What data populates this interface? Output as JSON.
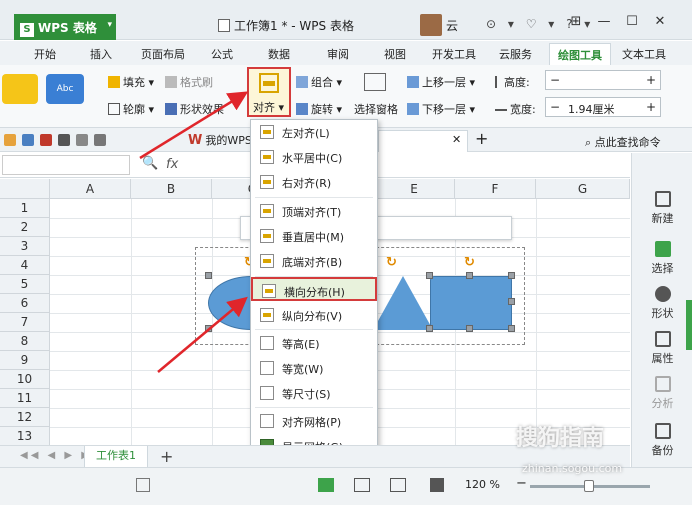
{
  "app": {
    "name": "WPS 表格",
    "logo": "S",
    "document_title": "工作簿1 * - WPS 表格",
    "user": "云",
    "title_icons": "⊙ ▾ ♡ ▾ ? ▾",
    "window_buttons": [
      "⊞",
      "—",
      "☐",
      "✕"
    ]
  },
  "tabs": [
    {
      "label": "开始"
    },
    {
      "label": "插入"
    },
    {
      "label": "页面布局"
    },
    {
      "label": "公式"
    },
    {
      "label": "数据"
    },
    {
      "label": "审阅"
    },
    {
      "label": "视图"
    },
    {
      "label": "开发工具"
    },
    {
      "label": "云服务"
    },
    {
      "label": "绘图工具"
    },
    {
      "label": "文本工具"
    }
  ],
  "ribbon": {
    "style_abc": "Abc",
    "fill": "填充 ▾",
    "format_brush": "格式刷",
    "outline": "轮廓 ▾",
    "shape_effect": "形状效果",
    "align": "对齐 ▾",
    "group": "组合 ▾",
    "rotate": "旋转 ▾",
    "selection_pane": "选择窗格",
    "bring_forward": "上移一层 ▾",
    "send_backward": "下移一层 ▾",
    "height_label": "高度:",
    "width_label": "宽度:",
    "height_value": "",
    "width_value": "1.94厘米",
    "minus": "−",
    "plus": "+"
  },
  "quickbar": {
    "doc_tab_prefix": "W",
    "doc_tab": "我的WPS",
    "close": "✕",
    "add": "+",
    "search": "点此查找命令"
  },
  "formula_bar": {
    "fx": "fx",
    "zoom_icon": "🔍"
  },
  "columns": [
    "A",
    "B",
    "C",
    "D",
    "E",
    "F",
    "G"
  ],
  "rows": [
    "1",
    "2",
    "3",
    "4",
    "5",
    "6",
    "7",
    "8",
    "9",
    "10",
    "11",
    "12",
    "13"
  ],
  "align_menu": [
    {
      "label": "左对齐(L)"
    },
    {
      "label": "水平居中(C)"
    },
    {
      "label": "右对齐(R)"
    },
    {
      "label": "顶端对齐(T)"
    },
    {
      "label": "垂直居中(M)"
    },
    {
      "label": "底端对齐(B)"
    },
    {
      "label": "横向分布(H)"
    },
    {
      "label": "纵向分布(V)"
    },
    {
      "label": "等高(E)"
    },
    {
      "label": "等宽(W)"
    },
    {
      "label": "等尺寸(S)"
    },
    {
      "label": "对齐网格(P)"
    },
    {
      "label": "显示网格(G)"
    }
  ],
  "sidebar": [
    {
      "label": "新建"
    },
    {
      "label": "选择"
    },
    {
      "label": "形状"
    },
    {
      "label": "属性"
    },
    {
      "label": "分析"
    },
    {
      "label": "备份"
    }
  ],
  "sheets": {
    "active": "工作表1",
    "nav": "◀◀ ◀ ▶ ▶▶",
    "add": "+"
  },
  "status": {
    "zoom": "120 %",
    "zoom_minus": "−"
  },
  "watermark": {
    "brand": "搜狗指南",
    "url": "zhinan.sogou.com"
  },
  "colors": {
    "accent_green": "#2f8f3a",
    "shape_blue": "#5b9bd5",
    "highlight_red": "#d43b3b",
    "arrow_red": "#e0262b"
  }
}
